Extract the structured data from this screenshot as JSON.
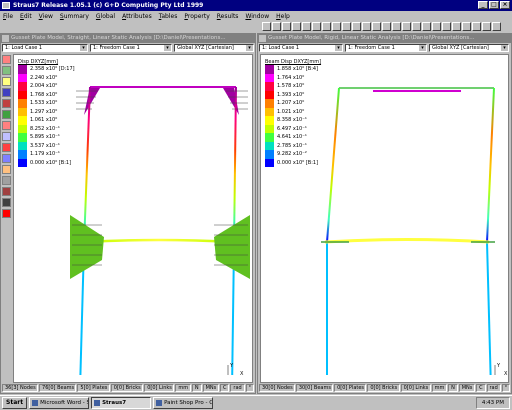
{
  "app": {
    "title": "Straus7 Release 1.05.1 (c) G+D Computing Pty Ltd 1999",
    "controls": [
      "_",
      "□",
      "×"
    ]
  },
  "menu": [
    "File",
    "Edit",
    "View",
    "Summary",
    "Global",
    "Attributes",
    "Tables",
    "Property",
    "Results",
    "Window",
    "Help"
  ],
  "left": {
    "title": "Gusset Plate Model, Straight, Linear Static Analysis [D:\\Daniel\\Presentations...",
    "load_case": "1: Load Case 1",
    "freedom_case": "1: Freedom Case 1",
    "coord": "Global XYZ [Cartesian]",
    "legend_title": "Disp DXYZ[mm]",
    "legend": [
      {
        "label": "2.358 x10⁰ [D:17]",
        "color": "#a000a0"
      },
      {
        "label": "2.240 x10⁰",
        "color": "#ff00ff"
      },
      {
        "label": "2.004 x10⁰",
        "color": "#ff0040"
      },
      {
        "label": "1.768 x10⁰",
        "color": "#ff0000"
      },
      {
        "label": "1.533 x10⁰",
        "color": "#ff8000"
      },
      {
        "label": "1.297 x10⁰",
        "color": "#ffc000"
      },
      {
        "label": "1.061 x10⁰",
        "color": "#ffff00"
      },
      {
        "label": "8.252 x10⁻¹",
        "color": "#c0ff00"
      },
      {
        "label": "5.895 x10⁻¹",
        "color": "#40ff40"
      },
      {
        "label": "3.537 x10⁻¹",
        "color": "#00e0c0"
      },
      {
        "label": "1.179 x10⁻¹",
        "color": "#0080ff"
      },
      {
        "label": "0.000 x10⁰ [B:1]",
        "color": "#0000ff"
      }
    ],
    "status": [
      "36[3] Nodes",
      "76[0] Beams",
      "5[0] Plates",
      "0[0] Bricks",
      "0[0] Links",
      "mm",
      "N",
      "MNs",
      "C",
      "rad",
      "°"
    ]
  },
  "right": {
    "title": "Gusset Plate Model, Rigid, Linear Static Analysis [D:\\Daniel\\Presentations...",
    "load_case": "1: Load Case 1",
    "freedom_case": "1: Freedom Case 1",
    "coord": "Global XYZ [Cartesian]",
    "legend_title": "Beam Disp DXYZ[mm]",
    "legend": [
      {
        "label": "1.858 x10⁰ [B:4]",
        "color": "#a000a0"
      },
      {
        "label": "1.764 x10⁰",
        "color": "#ff00ff"
      },
      {
        "label": "1.578 x10⁰",
        "color": "#ff0040"
      },
      {
        "label": "1.393 x10⁰",
        "color": "#ff0000"
      },
      {
        "label": "1.207 x10⁰",
        "color": "#ff8000"
      },
      {
        "label": "1.021 x10⁰",
        "color": "#ffc000"
      },
      {
        "label": "8.358 x10⁻¹",
        "color": "#ffff00"
      },
      {
        "label": "6.497 x10⁻¹",
        "color": "#c0ff00"
      },
      {
        "label": "4.641 x10⁻¹",
        "color": "#40ff40"
      },
      {
        "label": "2.785 x10⁻¹",
        "color": "#00e0c0"
      },
      {
        "label": "9.282 x10⁻²",
        "color": "#0080ff"
      },
      {
        "label": "0.000 x10⁰ [B:1]",
        "color": "#0000ff"
      }
    ],
    "status": [
      "30[0] Nodes",
      "30[0] Beams",
      "0[0] Plates",
      "0[0] Bricks",
      "0[0] Links",
      "mm",
      "N",
      "MNs",
      "C",
      "rad",
      "°"
    ]
  },
  "taskbar": {
    "start": "Start",
    "tasks": [
      "Microsoft Word - Str...",
      "Straus7",
      "Paint Shop Pro - Ca..."
    ],
    "active_index": 1,
    "time": "4:43 PM"
  },
  "axis_labels": {
    "y": "Y",
    "x": "X"
  }
}
